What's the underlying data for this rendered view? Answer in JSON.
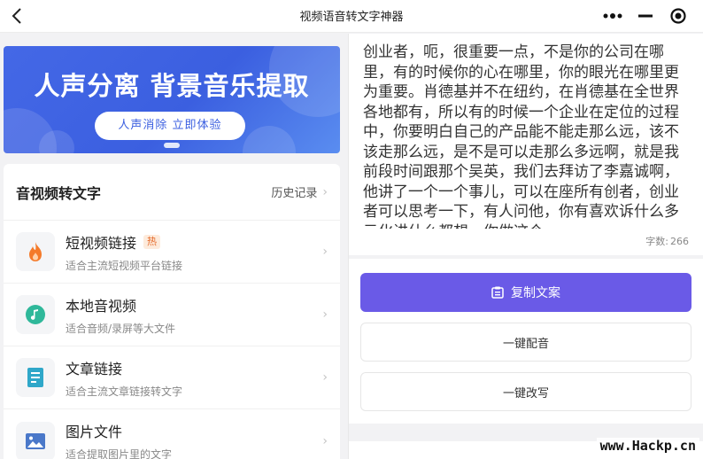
{
  "topbar": {
    "title": "视频语音转文字神器",
    "back_icon": "chevron-left-icon",
    "more_icon": "more-dots-icon",
    "minimize_icon": "minus-icon",
    "close_icon": "target-circle-icon"
  },
  "banner": {
    "title": "人声分离 背景音乐提取",
    "cta": "人声消除 立即体验"
  },
  "card": {
    "title": "音视频转文字",
    "history": "历史记录",
    "items": [
      {
        "icon": "flame-icon",
        "title": "短视频链接",
        "badge": "热",
        "subtitle": "适合主流短视频平台链接"
      },
      {
        "icon": "music-note-icon",
        "title": "本地音视频",
        "badge": "",
        "subtitle": "适合音频/录屏等大文件"
      },
      {
        "icon": "document-icon",
        "title": "文章链接",
        "badge": "",
        "subtitle": "适合主流文章链接转文字"
      },
      {
        "icon": "image-icon",
        "title": "图片文件",
        "badge": "",
        "subtitle": "适合提取图片里的文字"
      }
    ]
  },
  "result": {
    "text": "创业者，呃，很重要一点，不是你的公司在哪里，有的时候你的心在哪里，你的眼光在哪里更为重要。肖德基并不在纽约，在肖德基在全世界各地都有，所以有的时候一个企业在定位的过程中，你要明白自己的产品能不能走那么远，该不该走那么远，是不是可以走那么多远啊，就是我前段时间跟那个吴英，我们去拜访了李嘉诚啊，他讲了一个一个事儿，可以在座所有创者，创业者可以思考一下，有人问他，你有喜欢诉什么多元化讲什么都想，你做这个",
    "count_label": "字数:",
    "count": "266"
  },
  "actions": {
    "copy": "复制文案",
    "dub": "一键配音",
    "rewrite": "一键改写"
  },
  "colors": {
    "accent": "#6a5ae7",
    "banner": "#3b5fe0",
    "hot": "#e56a2a"
  },
  "watermark": "www.Hackp.cn"
}
